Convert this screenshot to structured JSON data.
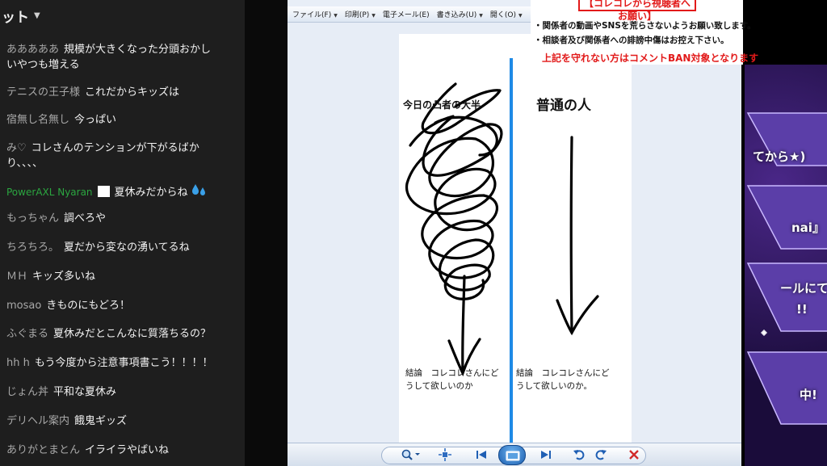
{
  "chat": {
    "header_title": "ット",
    "messages": [
      {
        "author": "あああああ",
        "text": "規模が大きくなった分頭おかし\nいやつも増える",
        "member": false
      },
      {
        "author": "テニスの王子様",
        "text": "これだからキッズは",
        "member": false
      },
      {
        "author": "宿無し名無し",
        "text": "今っぱい",
        "member": false
      },
      {
        "author": "み♡",
        "text": "コレさんのテンションが下がるばか\nり、、、、",
        "member": false
      },
      {
        "author": "PowerAXL Nyaran",
        "text": "夏休みだからね",
        "member": true
      },
      {
        "author": "もっちゃん",
        "text": "調べろや",
        "member": false
      },
      {
        "author": "ちろちろ。",
        "text": "夏だから変なの湧いてるね",
        "member": false
      },
      {
        "author": "ＭＨ",
        "text": "キッズ多いね",
        "member": false
      },
      {
        "author": "mosao",
        "text": "きものにもどろ！",
        "member": false
      },
      {
        "author": "ふぐまる",
        "text": "夏休みだとこんなに質落ちるの？",
        "member": false
      },
      {
        "author": "hh h",
        "text": "もう今度から注意事項書こう！！！！",
        "member": false
      },
      {
        "author": "じょん丼",
        "text": "平和な夏休み",
        "member": false
      },
      {
        "author": "デリヘル案内",
        "text": "餓鬼ギッズ",
        "member": false
      },
      {
        "author": "ありがとまとん",
        "text": "イライラやばいね",
        "member": false
      }
    ]
  },
  "viewer": {
    "menu": [
      {
        "label": "ファイル(F)"
      },
      {
        "label": "印刷(P)"
      },
      {
        "label": "電子メール(E)"
      },
      {
        "label": "書き込み(U)"
      },
      {
        "label": "開く(O)"
      }
    ],
    "doc": {
      "left_title": "今日の凸者の大半",
      "right_title": "普通の人",
      "left_conclusion": "結論　コレコレさんにど\nうして欲しいのか",
      "right_conclusion": "結論　コレコレさんにど\nうして欲しいのか。"
    },
    "toolbar_icons": [
      "zoom-icon",
      "fit-icon",
      "previous-icon",
      "slideshow-icon",
      "next-icon",
      "rotate-left-icon",
      "rotate-right-icon",
      "delete-icon"
    ]
  },
  "notice": {
    "title": "【コレコレから視聴者へお願い】",
    "lines": [
      "・関係者の動画やSNSを荒らさないようお願い致します。",
      "・相談者及び関係者への誹謗中傷はお控え下さい。"
    ],
    "warning": "上記を守れない方はコメントBAN対象となります"
  },
  "overlay": {
    "texts": [
      "てから★)",
      "nai』",
      "ールにて",
      "!!",
      "中!"
    ]
  },
  "colors": {
    "chat_bg": "#1e1e1e",
    "member_name": "#2ba640",
    "divider_blue": "#1e8ae6",
    "notice_red": "#e21a1a",
    "overlay_purple": "#3a1f70"
  }
}
